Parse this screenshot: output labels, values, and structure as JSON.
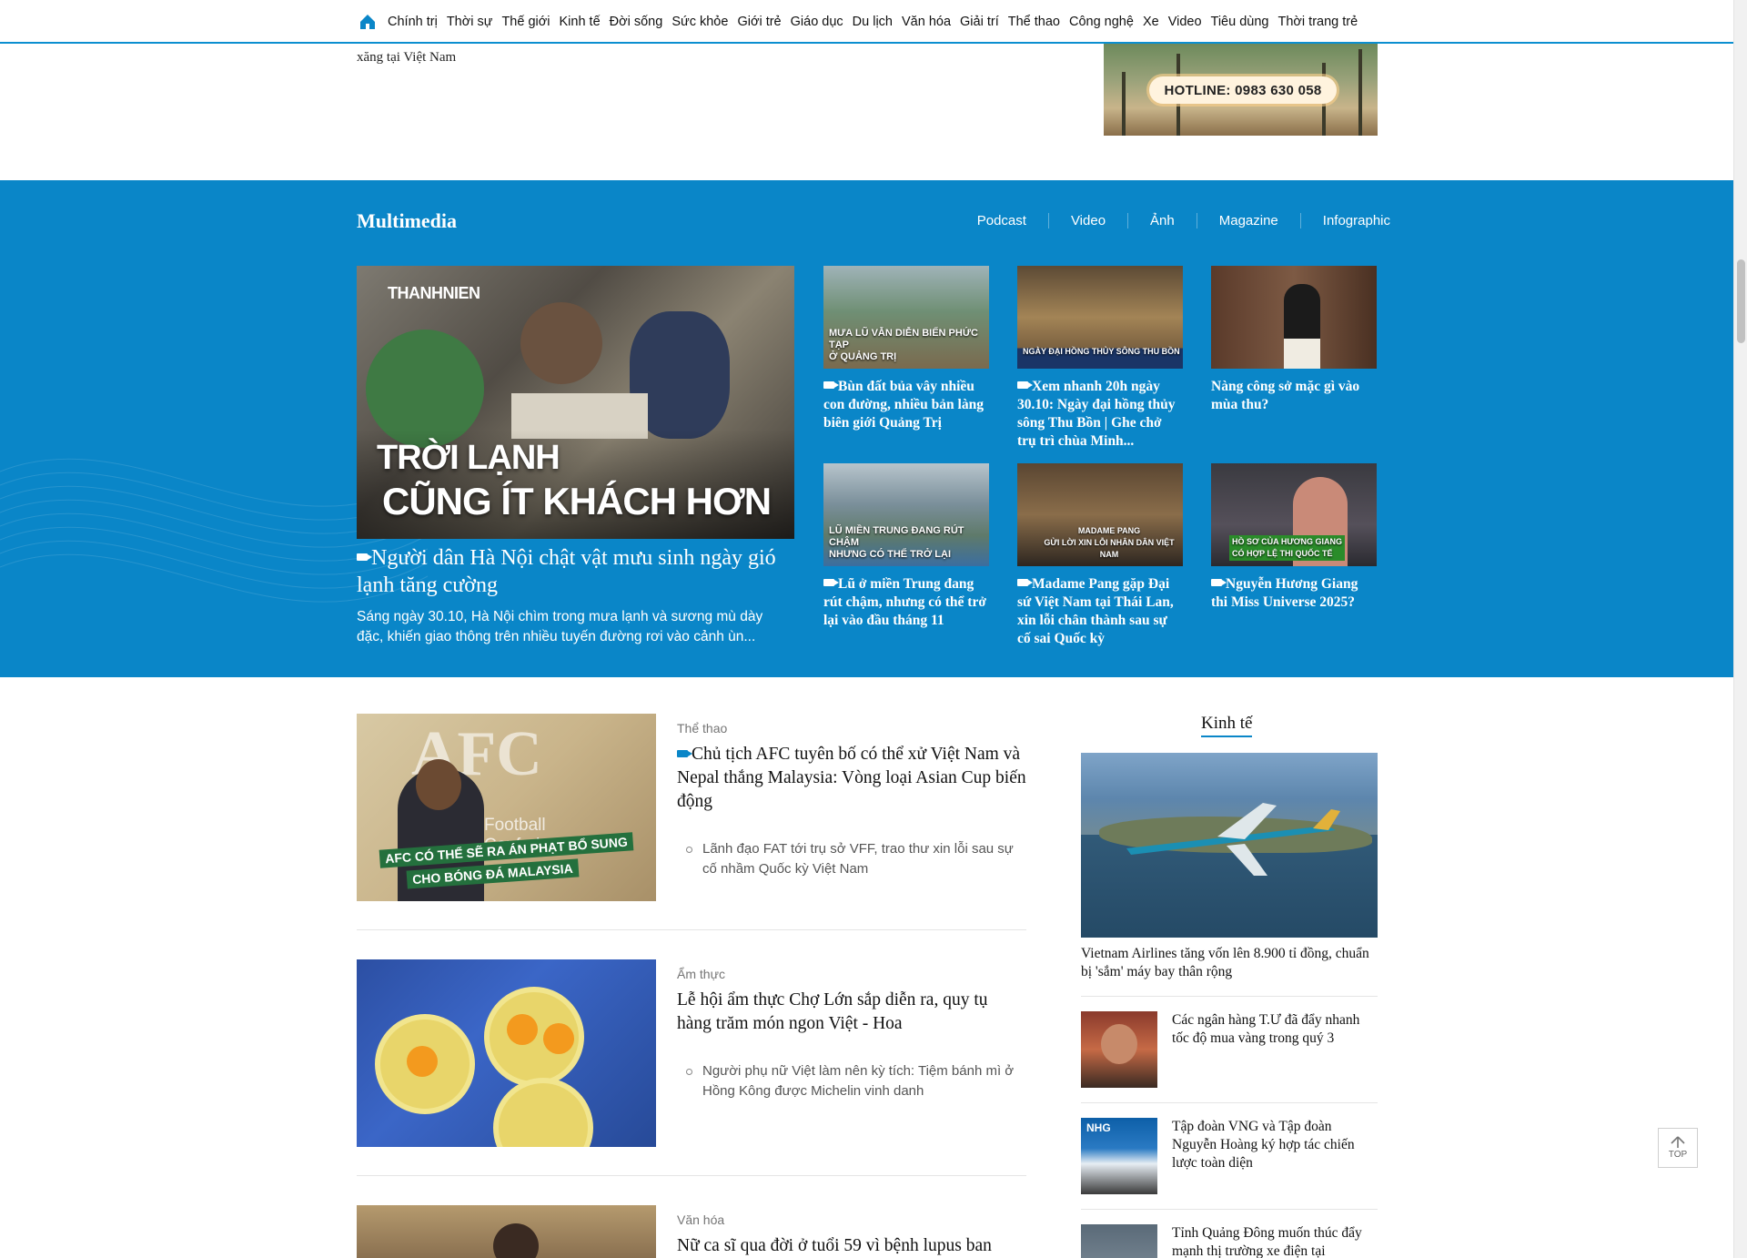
{
  "nav": {
    "items": [
      "Chính trị",
      "Thời sự",
      "Thế giới",
      "Kinh tế",
      "Đời sống",
      "Sức khỏe",
      "Giới trẻ",
      "Giáo dục",
      "Du lịch",
      "Văn hóa",
      "Giải trí",
      "Thể thao",
      "Công nghệ",
      "Xe",
      "Video",
      "Tiêu dùng",
      "Thời trang trẻ"
    ]
  },
  "top_fragment": {
    "text": "xăng tại Việt Nam"
  },
  "ad": {
    "hotline": "HOTLINE: 0983 630 058"
  },
  "multimedia": {
    "title": "Multimedia",
    "tabs": [
      "Podcast",
      "Video",
      "Ảnh",
      "Magazine",
      "Infographic"
    ],
    "hero": {
      "logo": "THANHNIEN",
      "overlay_line1": "TRỜI LẠNH",
      "overlay_line2": "CŨNG ÍT KHÁCH HƠN",
      "title": "Người dân Hà Nội chật vật mưu sinh ngày gió lạnh tăng cường",
      "desc": "Sáng ngày 30.10, Hà Nội chìm trong mưa lạnh và sương mù dày đặc, khiến giao thông trên nhiều tuyến đường rơi vào cảnh ùn..."
    },
    "cards": [
      {
        "caption": "MƯA LŨ VẪN DIỄN BIẾN PHỨC TẠP\nỞ QUẢNG TRỊ",
        "title": "Bùn đất bủa vây nhiều con đường, nhiều bản làng biên giới Quảng Trị",
        "video": true
      },
      {
        "caption": "NGÀY ĐẠI HỒNG THỦY SÔNG THU BỒN",
        "title": "Xem nhanh 20h ngày 30.10: Ngày đại hồng thủy sông Thu Bồn | Ghe chở trụ trì chùa Minh...",
        "video": true
      },
      {
        "caption": "",
        "title": "Nàng công sở mặc gì vào mùa thu?",
        "video": false
      },
      {
        "caption": "LŨ MIỀN TRUNG ĐANG RÚT CHẬM\nNHƯNG CÓ THỂ TRỞ LẠI",
        "title": "Lũ ở miền Trung đang rút chậm, nhưng có thể trở lại vào đầu tháng 11",
        "video": true
      },
      {
        "caption": "MADAME PANG\nGỬI LỜI XIN LỖI NHÂN DÂN VIỆT NAM",
        "title": "Madame Pang gặp Đại sứ Việt Nam tại Thái Lan, xin lỗi chân thành sau sự cố sai Quốc kỳ",
        "video": true
      },
      {
        "caption": "HỒ SƠ CỦA HƯƠNG GIANG\nCÓ HỢP LỆ THI QUỐC TẾ",
        "title": "Nguyễn Hương Giang thi Miss Universe 2025?",
        "video": true
      }
    ]
  },
  "list": [
    {
      "category": "Thể thao",
      "title": "Chủ tịch AFC tuyên bố có thể xử Việt Nam và Nepal thắng Malaysia: Vòng loại Asian Cup biến động",
      "video": true,
      "img_caption1": "AFC CÓ THỂ SẼ RA ÁN PHẠT BỔ SUNG",
      "img_caption2": "CHO BÓNG ĐÁ MALAYSIA",
      "img_text": "Football Confederation",
      "related": "Lãnh đạo FAT tới trụ sở VFF, trao thư xin lỗi sau sự cố nhầm Quốc kỳ Việt Nam"
    },
    {
      "category": "Ẩm thực",
      "title": "Lễ hội ẩm thực Chợ Lớn sắp diễn ra, quy tụ hàng trăm món ngon Việt - Hoa",
      "video": false,
      "related": "Người phụ nữ Việt làm nên kỳ tích: Tiệm bánh mì ở Hồng Kông được Michelin vinh danh"
    },
    {
      "category": "Văn hóa",
      "title": "Nữ ca sĩ qua đời ở tuổi 59 vì bệnh lupus ban",
      "video": false
    }
  ],
  "sidebar": {
    "title": "Kinh tế",
    "hero_title": "Vietnam Airlines tăng vốn lên 8.900 tỉ đồng, chuẩn bị 'sắm' máy bay thân rộng",
    "items": [
      {
        "title": "Các ngân hàng T.Ư đã đẩy nhanh tốc độ mua vàng trong quý 3"
      },
      {
        "title": "Tập đoàn VNG và Tập đoàn Nguyễn Hoàng ký hợp tác chiến lược toàn diện"
      },
      {
        "title": "Tỉnh Quảng Đông muốn thúc đẩy mạnh thị trường xe điện tại"
      }
    ]
  },
  "top_button": {
    "label": "TOP"
  }
}
